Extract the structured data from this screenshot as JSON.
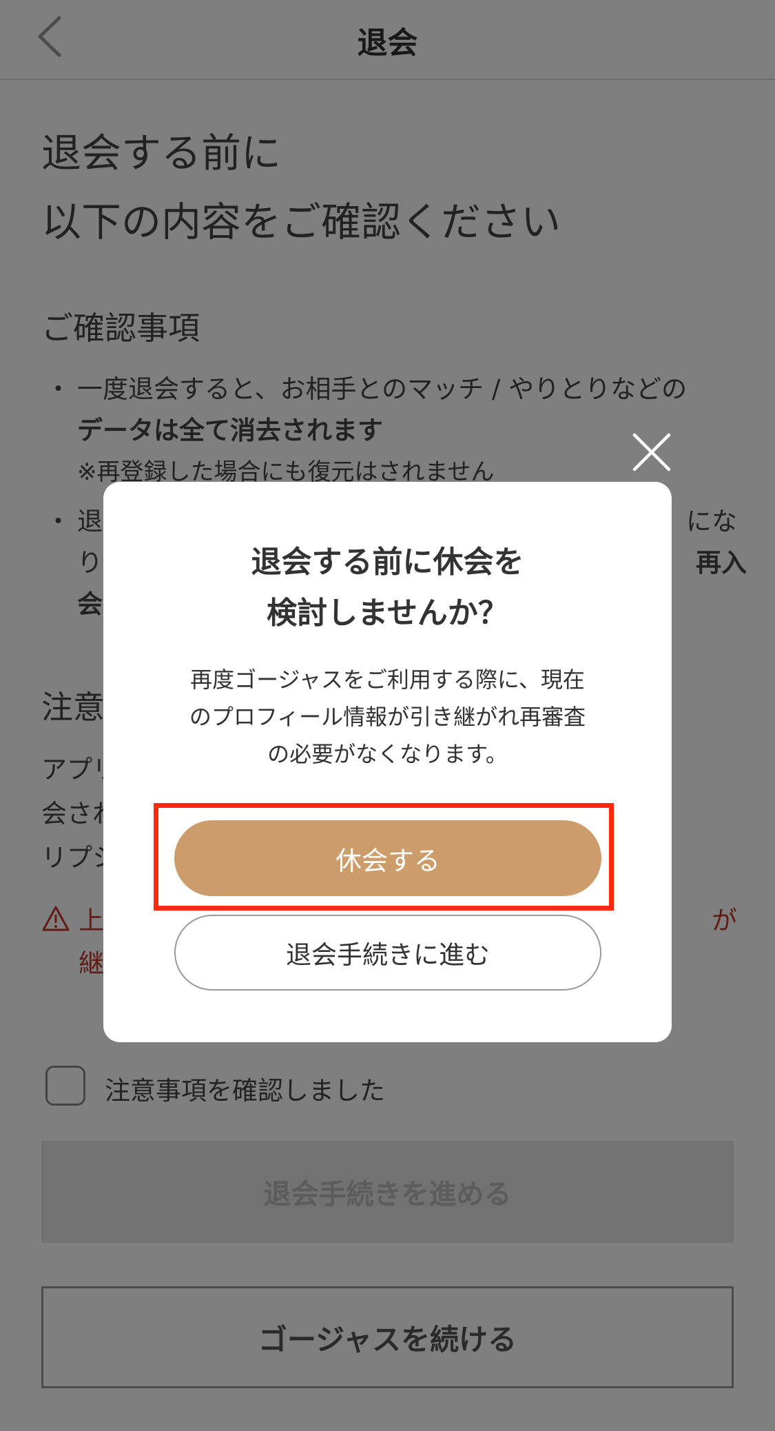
{
  "nav": {
    "title": "退会"
  },
  "intro": {
    "line1": "退会する前に",
    "line2": "以下の内容をご確認ください"
  },
  "confirm_section": {
    "title": "ご確認事項",
    "bullet1_text": "一度退会すると、お相手とのマッチ / やりとりなどの",
    "bullet1_bold": "データは全て消去されます",
    "bullet1_note": "※再登録した場合にも復元はされません",
    "bullet2_text": "退",
    "bullet2_right": "にな",
    "bullet2_line2_left": "り",
    "bullet2_line2_right": "再入",
    "bullet2_line3": "会"
  },
  "caution_section": {
    "title": "注意",
    "line1": "アプリ",
    "line2": "会され",
    "line3": "リプシ",
    "warning_left": "上",
    "warning_right": "が",
    "warning_line2": "継"
  },
  "agree": {
    "label": "注意事項を確認しました"
  },
  "buttons": {
    "proceed": "退会手続きを進める",
    "continue": "ゴージャスを続ける"
  },
  "modal": {
    "title_line1": "退会する前に休会を",
    "title_line2": "検討しませんか？",
    "desc_line1": "再度ゴージャスをご利用する際に、現在",
    "desc_line2": "のプロフィール情報が引き継がれ再審査",
    "desc_line3": "の必要がなくなります。",
    "suspend_label": "休会する",
    "withdraw_label": "退会手続きに進む"
  },
  "colors": {
    "accent": "#cd9c6b",
    "highlight": "#ff2a10",
    "warning": "#c0392b"
  }
}
